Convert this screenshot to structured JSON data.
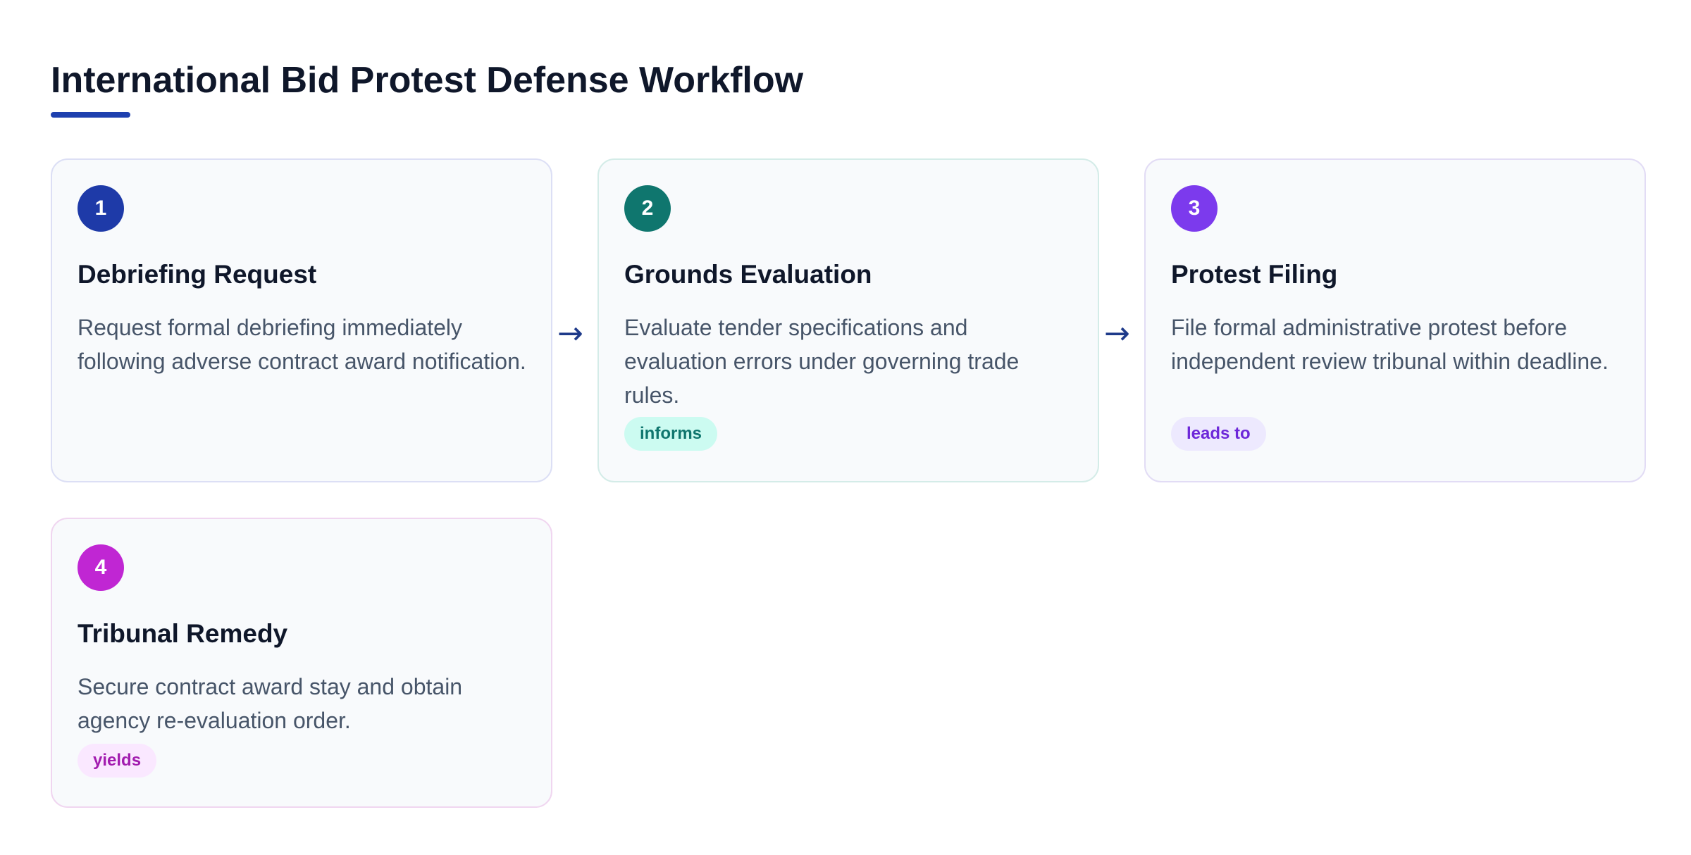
{
  "page": {
    "title": "International Bid Protest Defense Workflow"
  },
  "steps": [
    {
      "number": "1",
      "title": "Debriefing Request",
      "description": "Request formal debriefing immediately following adverse contract award notification.",
      "tag": "",
      "color": "#1e3aa8"
    },
    {
      "number": "2",
      "title": "Grounds Evaluation",
      "description": "Evaluate tender specifications and evaluation errors under governing trade rules.",
      "tag": "informs",
      "color": "#0f766e"
    },
    {
      "number": "3",
      "title": "Protest Filing",
      "description": "File formal administrative protest before independent review tribunal within deadline.",
      "tag": "leads to",
      "color": "#7c3aed"
    },
    {
      "number": "4",
      "title": "Tribunal Remedy",
      "description": "Secure contract award stay and obtain agency re-evaluation order.",
      "tag": "yields",
      "color": "#c026d3"
    }
  ],
  "connectors": {
    "arrow_symbol": "→",
    "icon": "right-arrow-icon"
  },
  "colors": {
    "accent": "#1e40af",
    "title_text": "#0f172a",
    "body_text": "#475569",
    "card_background": "#f8fafc"
  }
}
